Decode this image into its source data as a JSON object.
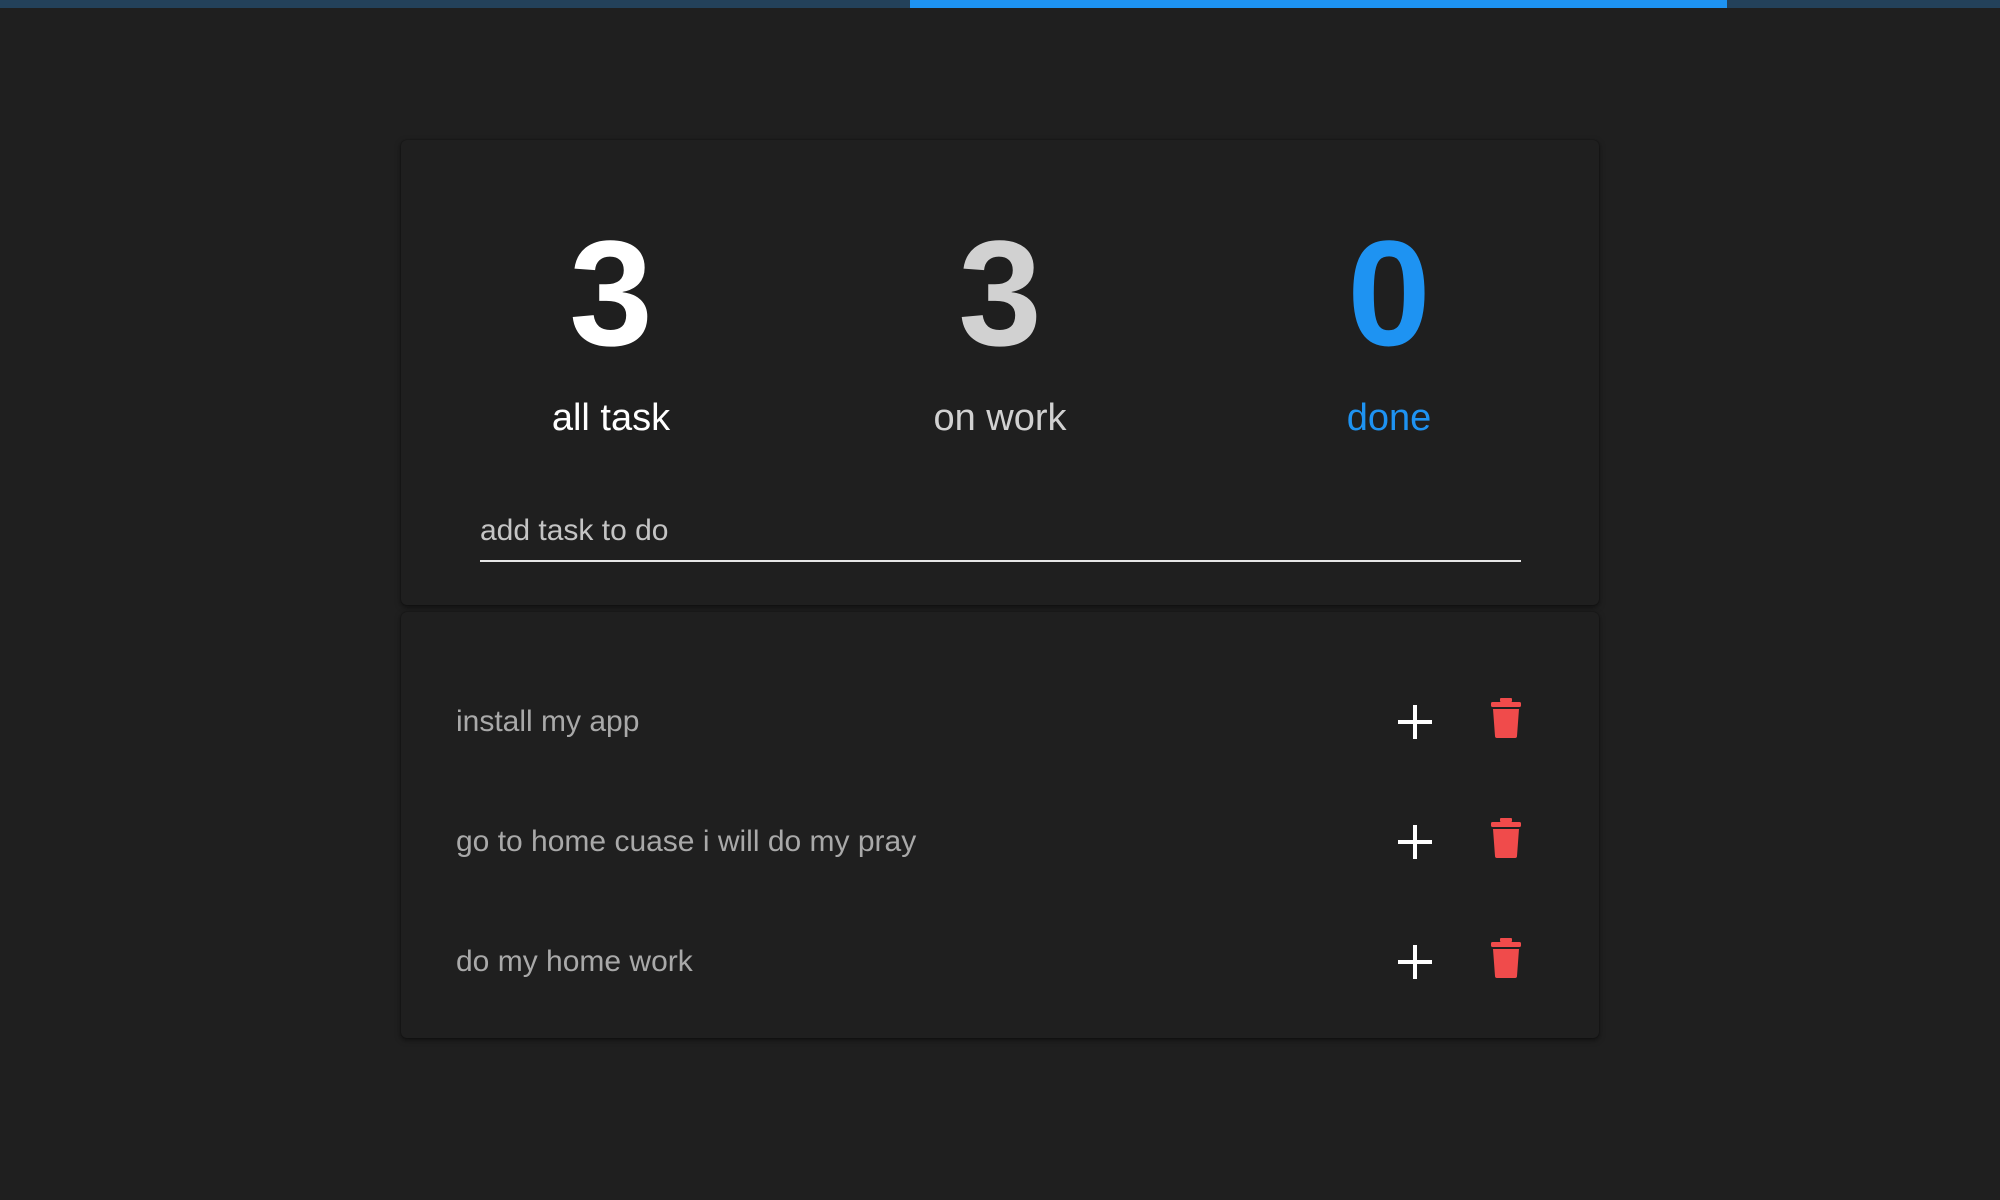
{
  "progress": {
    "done_fraction": 0.41,
    "track_color": "#23415a",
    "fill_color": "#1e93f2"
  },
  "stats": [
    {
      "count": "3",
      "label": "all task",
      "color": "#ffffff"
    },
    {
      "count": "3",
      "label": "on work",
      "color": "#d1d1d1"
    },
    {
      "count": "0",
      "label": "done",
      "color": "#1e93f2"
    }
  ],
  "input": {
    "placeholder": "add task to do",
    "value": ""
  },
  "tasks": [
    {
      "text": "install my app",
      "add_icon": "plus-icon",
      "delete_icon": "trash-icon"
    },
    {
      "text": "go to home cuase i will do my pray",
      "add_icon": "plus-icon",
      "delete_icon": "trash-icon"
    },
    {
      "text": "do my home work",
      "add_icon": "plus-icon",
      "delete_icon": "trash-icon"
    }
  ],
  "colors": {
    "background": "#1f1f1f",
    "accent": "#1e93f2",
    "delete": "#f04b4b"
  }
}
